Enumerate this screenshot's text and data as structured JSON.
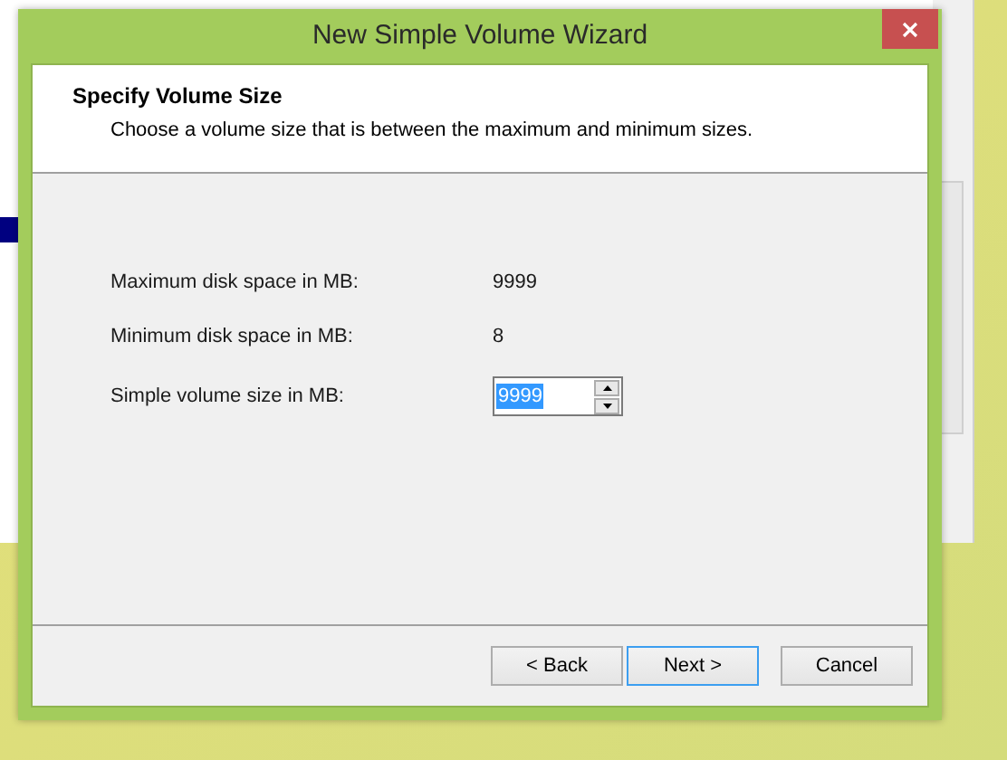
{
  "wizard": {
    "title": "New Simple Volume Wizard",
    "header": {
      "title": "Specify Volume Size",
      "subtitle": "Choose a volume size that is between the maximum and minimum sizes."
    },
    "fields": [
      {
        "kind": "readout",
        "label": "Maximum disk space in MB:",
        "value": "9999"
      },
      {
        "kind": "readout",
        "label": "Minimum disk space in MB:",
        "value": "8"
      },
      {
        "kind": "spinner",
        "label": "Simple volume size in MB:",
        "value": "9999",
        "text_selected": true
      }
    ],
    "buttons": [
      {
        "label": "< Back",
        "default": false
      },
      {
        "label": "Next >",
        "default": true
      },
      {
        "label": "Cancel",
        "default": false
      }
    ]
  }
}
